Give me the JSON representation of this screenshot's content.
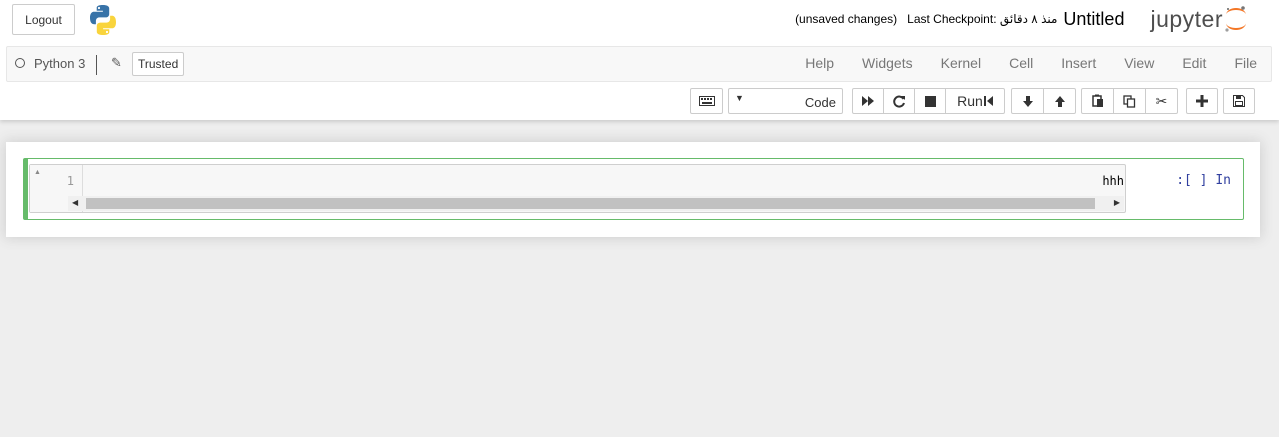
{
  "header": {
    "logout_label": "Logout",
    "brand": "jupyter",
    "notebook_title": "Untitled",
    "checkpoint_text": "Last Checkpoint: منذ ٨ دقائق",
    "unsaved_text": "(unsaved changes)"
  },
  "kernel": {
    "name": "Python 3",
    "trusted_label": "Trusted",
    "indicator_icon": "kernel-idle-icon"
  },
  "menu": {
    "items": [
      "File",
      "Edit",
      "View",
      "Insert",
      "Cell",
      "Kernel",
      "Widgets",
      "Help"
    ]
  },
  "toolbar": {
    "cell_type": "Code",
    "run_label": "Run",
    "icons": [
      "save-icon",
      "insert-cell-below-icon",
      "cut-icon",
      "copy-icon",
      "paste-icon",
      "move-up-icon",
      "move-down-icon",
      "interrupt-icon",
      "restart-icon",
      "restart-run-all-icon",
      "command-palette-icon"
    ]
  },
  "cell": {
    "prompt": "In [ ]:",
    "line_number": "1",
    "code": "hhh"
  },
  "colors": {
    "accent_orange": "#f37626",
    "cell_border": "#66bb6a",
    "prompt_blue": "#303f9f"
  }
}
